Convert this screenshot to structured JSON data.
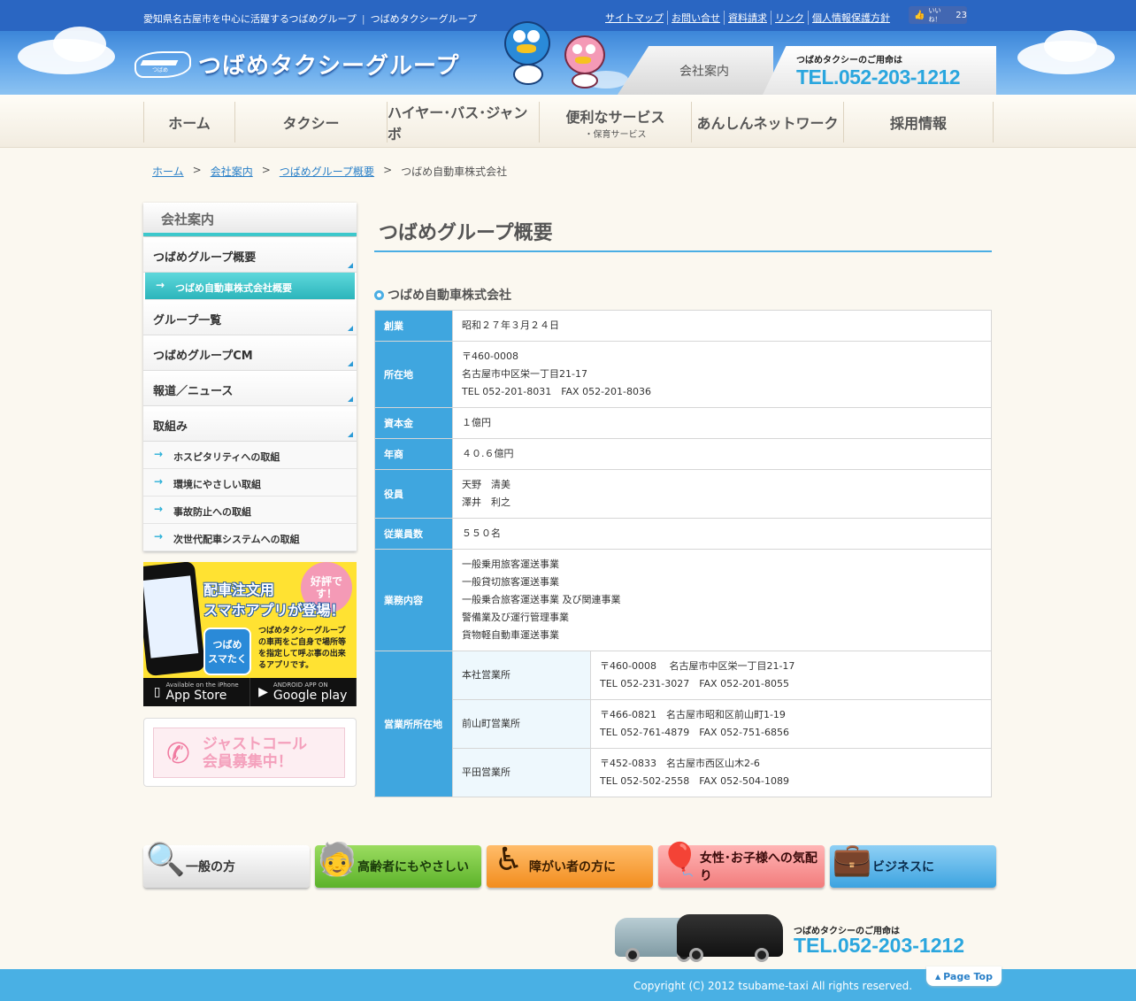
{
  "header": {
    "tagline1": "愛知県名古屋市を中心に活躍するつばめグループ",
    "tagline2": "つばめタクシーグループ",
    "logo_text": "つばめタクシーグループ",
    "logo_mark_text": "つばめ",
    "top_links": [
      "サイトマップ",
      "お問い合せ",
      "資料請求",
      "リンク",
      "個人情報保護方針"
    ],
    "fb_label": "いいね！",
    "fb_count": "23",
    "company_tab": "会社案内",
    "tel_label": "つばめタクシーのご用命は",
    "tel_number": "TEL.052-203-1212"
  },
  "nav": [
    {
      "label": "ホーム",
      "sub": ""
    },
    {
      "label": "タクシー",
      "sub": ""
    },
    {
      "label": "ハイヤー･バス･ジャンボ",
      "sub": ""
    },
    {
      "label": "便利なサービス",
      "sub": "・保育サービス"
    },
    {
      "label": "あんしんネットワーク",
      "sub": ""
    },
    {
      "label": "採用情報",
      "sub": ""
    }
  ],
  "breadcrumb": {
    "links": [
      "ホーム",
      "会社案内",
      "つばめグループ概要"
    ],
    "current": "つばめ自動車株式会社",
    "separator": ">"
  },
  "sidebar": {
    "heading": "会社案内",
    "item1": "つばめグループ概要",
    "active_sub": "つばめ自動車株式会社概要",
    "item2": "グループ一覧",
    "item3": "つばめグループCM",
    "item4": "報道／ニュース",
    "item5": "取組み",
    "subs": [
      "ホスピタリティへの取組",
      "環境にやさしい取組",
      "事故防止への取組",
      "次世代配車システムへの取組"
    ]
  },
  "app_banner": {
    "popular": "好評です！",
    "title_line1": "配車注文用",
    "title_line2": "スマホアプリが登場！",
    "icon_line1": "つばめ",
    "icon_line2": "スマたく",
    "desc": "つばめタクシーグループの車両をご自身で場所等を指定して呼ぶ事の出来るアプリです。",
    "appstore_small": "Available on the iPhone",
    "appstore": "App Store",
    "googleplay_small": "ANDROID APP ON",
    "googleplay": "Google play"
  },
  "justcall": {
    "line1": "ジャストコール",
    "line2": "会員募集中！"
  },
  "main": {
    "page_title": "つばめグループ概要",
    "section_title": "つばめ自動車株式会社",
    "rows": {
      "founded_label": "創業",
      "founded": "昭和２７年３月２４日",
      "address_label": "所在地",
      "address_zip": "〒460-0008",
      "address_line": "名古屋市中区栄一丁目21-17",
      "address_tel": "TEL 052-201-8031　FAX 052-201-8036",
      "capital_label": "資本金",
      "capital": "１億円",
      "sales_label": "年商",
      "sales": "４０.６億円",
      "officers_label": "役員",
      "officer1": "天野　清美",
      "officer2": "澤井　利之",
      "employees_label": "従業員数",
      "employees": "５５０名",
      "business_label": "業務内容",
      "business": [
        "一般乗用旅客運送事業",
        "一般貸切旅客運送事業",
        "一般乗合旅客運送事業 及び関連事業",
        "警備業及び運行管理事業",
        "貨物軽自動車運送事業"
      ],
      "offices_label": "営業所所在地",
      "offices": [
        {
          "name": "本社営業所",
          "addr": "〒460-0008　 名古屋市中区栄一丁目21-17",
          "tel": "TEL 052-231-3027　FAX 052-201-8055"
        },
        {
          "name": "前山町営業所",
          "addr": "〒466-0821　名古屋市昭和区前山町1-19",
          "tel": "TEL 052-761-4879　FAX 052-751-6856"
        },
        {
          "name": "平田営業所",
          "addr": "〒452-0833　名古屋市西区山木2-6",
          "tel": "TEL 052-502-2558　FAX 052-504-1089"
        }
      ]
    }
  },
  "bottom_buttons": [
    "一般の方",
    "高齢者にもやさしい",
    "障がい者の方に",
    "女性･お子様への気配り",
    "ビジネスに"
  ],
  "footer": {
    "tel_label": "つばめタクシーのご用命は",
    "tel_number": "TEL.052-203-1212",
    "copyright": "Copyright (C) 2012 tsubame-taxi All rights reserved.",
    "pagetop": "Page Top"
  },
  "colors": {
    "accent_blue": "#3fa6df",
    "teal": "#3cc8cc",
    "header_blue": "#2f70c9",
    "footer_blue": "#49b0e4"
  }
}
